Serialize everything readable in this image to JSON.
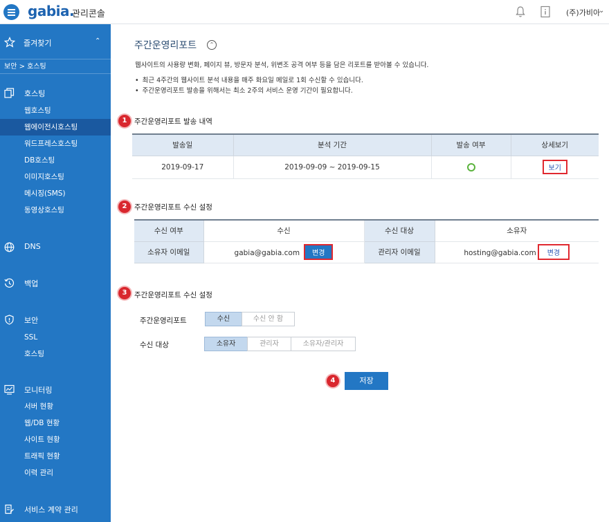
{
  "header": {
    "logo": "gabia.",
    "console_title": "관리콘솔",
    "user": "(주)가비아",
    "icons": [
      "menu-icon",
      "bell-icon",
      "document-icon",
      "chevron-down-icon"
    ]
  },
  "sidebar": {
    "favorites": "즐겨찾기",
    "breadcrumb": "보안 > 호스팅",
    "groups": {
      "hosting": {
        "title": "호스팅",
        "items": [
          "웹호스팅",
          "웹에이전시호스팅",
          "워드프레스호스팅",
          "DB호스팅",
          "이미지호스팅",
          "메시징(SMS)",
          "동영상호스팅"
        ]
      },
      "dns": {
        "title": "DNS"
      },
      "backup": {
        "title": "백업"
      },
      "security": {
        "title": "보안",
        "items": [
          "SSL",
          "호스팅"
        ]
      },
      "monitoring": {
        "title": "모니터링",
        "items": [
          "서버 현황",
          "웹/DB 현황",
          "사이트 현황",
          "트래픽 현황",
          "이력 관리"
        ]
      },
      "contract": {
        "title": "서비스 계약 관리"
      }
    },
    "active_item": "웹에이전시호스팅"
  },
  "main": {
    "title": "주간운영리포트",
    "description": "웹사이트의 사용량 변화, 페이지 뷰, 방문자 분석, 위변조 공격 여부 등을 담은 리포트를 받아볼 수 있습니다.",
    "bullets": [
      "최근 4주간의 웹사이트 분석 내용을 매주 화요일 메일로 1회 수신할 수 있습니다.",
      "주간운영리포트 발송을 위해서는 최소 2주의 서비스 운영 기간이 필요합니다."
    ],
    "steps": [
      "1",
      "2",
      "3",
      "4"
    ],
    "history": {
      "title": "주간운영리포트 발송 내역",
      "headers": [
        "발송일",
        "분석 기간",
        "발송 여부",
        "상세보기"
      ],
      "row": {
        "date": "2019-09-17",
        "period": "2019-09-09 ~ 2019-09-15",
        "status": "sent",
        "view": "보기"
      }
    },
    "recv_settings": {
      "title": "주간운영리포트 수신 설정",
      "recv_label": "수신 여부",
      "recv_value": "수신",
      "target_label": "수신 대상",
      "target_value": "소유자",
      "owner_email_label": "소유자 이메일",
      "owner_email": "gabia@gabia.com",
      "admin_email_label": "관리자 이메일",
      "admin_email": "hosting@gabia.com",
      "change": "변경"
    },
    "form": {
      "title": "주간운영리포트 수신 설정",
      "report_label": "주간운영리포트",
      "report_options": [
        "수신",
        "수신 안 함"
      ],
      "report_selected": "수신",
      "target_label": "수신 대상",
      "target_options": [
        "소유자",
        "관리자",
        "소유자/관리자"
      ],
      "target_selected": "소유자"
    },
    "save": "저장"
  },
  "colors": {
    "brand": "#2377c4",
    "highlight": "#e0282f",
    "ok": "#5ab33c"
  }
}
